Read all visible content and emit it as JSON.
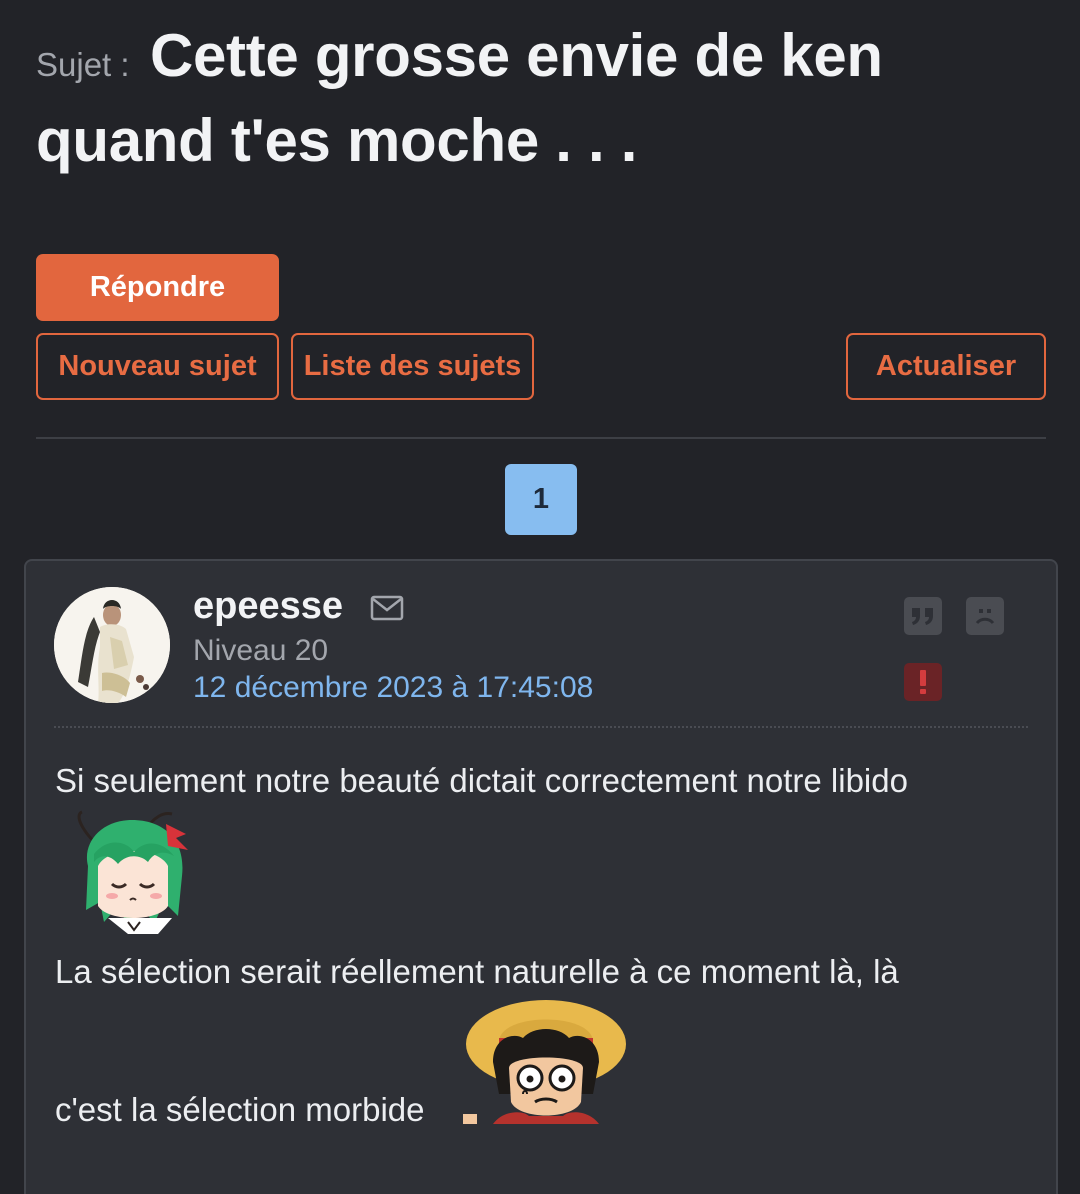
{
  "topic": {
    "prefix": "Sujet :",
    "title": "Cette grosse envie de ken quand t'es moche . . ."
  },
  "actions": {
    "reply_label": "Répondre",
    "new_topic_label": "Nouveau sujet",
    "topic_list_label": "Liste des sujets",
    "refresh_label": "Actualiser"
  },
  "pagination": {
    "current_page": "1"
  },
  "post": {
    "author": "epeesse",
    "level": "Niveau 20",
    "date": "12 décembre 2023 à 17:45:08",
    "lines": [
      "Si seulement notre beauté dictait correctement notre libido",
      "La sélection serait réellement naturelle à ce moment là, là",
      "c'est la sélection morbide"
    ],
    "stickers": [
      "green-haired-anime-sticker",
      "luffy-sticker"
    ],
    "icons": {
      "mail": "mail-icon",
      "quote": "quote-icon",
      "blame": "sad-face-icon",
      "report": "exclamation-icon"
    }
  },
  "colors": {
    "background": "#222328",
    "card": "#2e3036",
    "accent": "#e2663e",
    "link": "#7fb6ee",
    "page_active": "#87bdf0",
    "report": "#6a2326"
  }
}
